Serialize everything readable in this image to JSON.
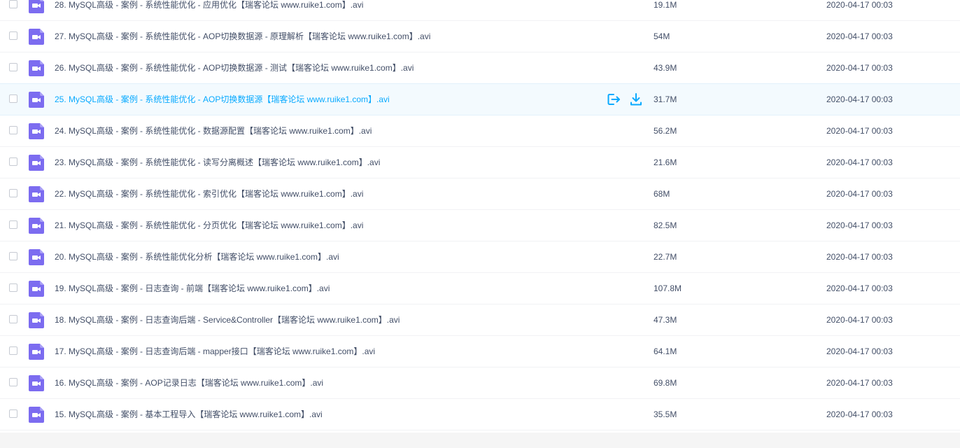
{
  "colors": {
    "text": "#424e67",
    "accent": "#09aaff",
    "video_icon": "#7c6cf0",
    "row_highlight": "#f3fafe"
  },
  "row_actions": {
    "share_icon": "share-out-icon",
    "download_icon": "download-icon"
  },
  "files": [
    {
      "name": "28. MySQL高级 - 案例 - 系统性能优化 - 应用优化【瑞客论坛 www.ruike1.com】.avi",
      "size": "19.1M",
      "date": "2020-04-17 00:03",
      "icon": "video-file-icon"
    },
    {
      "name": "27. MySQL高级 - 案例 - 系统性能优化 - AOP切换数据源 - 原理解析【瑞客论坛 www.ruike1.com】.avi",
      "size": "54M",
      "date": "2020-04-17 00:03",
      "icon": "video-file-icon"
    },
    {
      "name": "26. MySQL高级 - 案例 - 系统性能优化 - AOP切换数据源 - 测试【瑞客论坛 www.ruike1.com】.avi",
      "size": "43.9M",
      "date": "2020-04-17 00:03",
      "icon": "video-file-icon"
    },
    {
      "name": "25. MySQL高级 - 案例 - 系统性能优化 - AOP切换数据源【瑞客论坛 www.ruike1.com】.avi",
      "size": "31.7M",
      "date": "2020-04-17 00:03",
      "icon": "video-file-icon",
      "hovered": true
    },
    {
      "name": "24. MySQL高级 - 案例 - 系统性能优化 - 数据源配置【瑞客论坛 www.ruike1.com】.avi",
      "size": "56.2M",
      "date": "2020-04-17 00:03",
      "icon": "video-file-icon"
    },
    {
      "name": "23. MySQL高级 - 案例 - 系统性能优化 - 读写分离概述【瑞客论坛 www.ruike1.com】.avi",
      "size": "21.6M",
      "date": "2020-04-17 00:03",
      "icon": "video-file-icon"
    },
    {
      "name": "22. MySQL高级 - 案例 - 系统性能优化 - 索引优化【瑞客论坛 www.ruike1.com】.avi",
      "size": "68M",
      "date": "2020-04-17 00:03",
      "icon": "video-file-icon"
    },
    {
      "name": "21. MySQL高级 - 案例 - 系统性能优化 - 分页优化【瑞客论坛 www.ruike1.com】.avi",
      "size": "82.5M",
      "date": "2020-04-17 00:03",
      "icon": "video-file-icon"
    },
    {
      "name": "20. MySQL高级 - 案例 - 系统性能优化分析【瑞客论坛 www.ruike1.com】.avi",
      "size": "22.7M",
      "date": "2020-04-17 00:03",
      "icon": "video-file-icon"
    },
    {
      "name": "19. MySQL高级 - 案例 - 日志查询 - 前端【瑞客论坛 www.ruike1.com】.avi",
      "size": "107.8M",
      "date": "2020-04-17 00:03",
      "icon": "video-file-icon"
    },
    {
      "name": "18. MySQL高级 - 案例 - 日志查询后端 - Service&Controller【瑞客论坛 www.ruike1.com】.avi",
      "size": "47.3M",
      "date": "2020-04-17 00:03",
      "icon": "video-file-icon"
    },
    {
      "name": "17. MySQL高级 - 案例 - 日志查询后端 - mapper接口【瑞客论坛 www.ruike1.com】.avi",
      "size": "64.1M",
      "date": "2020-04-17 00:03",
      "icon": "video-file-icon"
    },
    {
      "name": "16. MySQL高级 - 案例 - AOP记录日志【瑞客论坛 www.ruike1.com】.avi",
      "size": "69.8M",
      "date": "2020-04-17 00:03",
      "icon": "video-file-icon"
    },
    {
      "name": "15. MySQL高级 - 案例 - 基本工程导入【瑞客论坛 www.ruike1.com】.avi",
      "size": "35.5M",
      "date": "2020-04-17 00:03",
      "icon": "video-file-icon"
    }
  ]
}
